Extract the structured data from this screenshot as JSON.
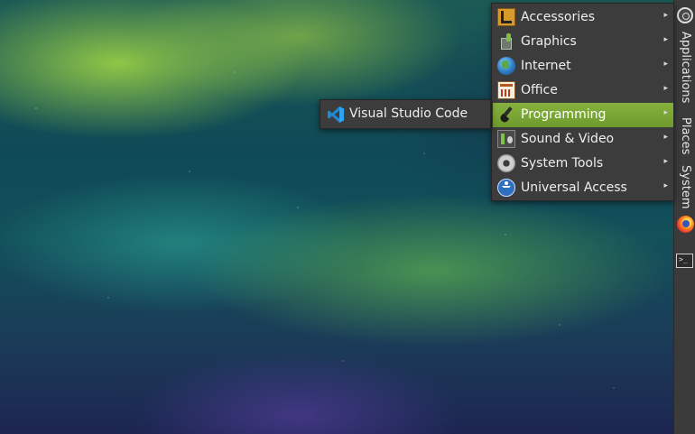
{
  "panel": {
    "applications_label": "Applications",
    "places_label": "Places",
    "system_label": "System",
    "terminal_glyph": ">_"
  },
  "menu": {
    "items": [
      {
        "label": "Accessories",
        "icon": "accessories-icon",
        "arrow": "▸"
      },
      {
        "label": "Graphics",
        "icon": "graphics-icon",
        "arrow": "▸"
      },
      {
        "label": "Internet",
        "icon": "globe-icon",
        "arrow": "▸"
      },
      {
        "label": "Office",
        "icon": "office-icon",
        "arrow": "▸"
      },
      {
        "label": "Programming",
        "icon": "programming-icon",
        "arrow": "▸",
        "active": true
      },
      {
        "label": "Sound & Video",
        "icon": "sound-video-icon",
        "arrow": "▸"
      },
      {
        "label": "System Tools",
        "icon": "gear-icon",
        "arrow": "▸"
      },
      {
        "label": "Universal Access",
        "icon": "accessibility-icon",
        "arrow": "▸"
      }
    ]
  },
  "submenu": {
    "items": [
      {
        "label": "Visual Studio Code",
        "icon": "vscode-icon"
      }
    ]
  },
  "colors": {
    "menu_bg": "#3c3c3c",
    "active_item": "#7aa636",
    "panel_bg": "#3b3b3b"
  }
}
